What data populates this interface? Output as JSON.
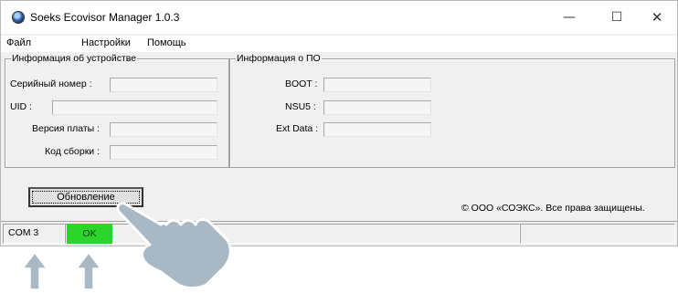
{
  "window": {
    "title": "Soeks Ecovisor Manager 1.0.3",
    "controls": {
      "minimize": "—",
      "maximize": "☐",
      "close": "✕"
    }
  },
  "menu": {
    "file": "Файл",
    "settings": "Настройки",
    "help": "Помощь"
  },
  "device_info": {
    "legend": "Информация об устройстве",
    "serial_label": "Серийный номер :",
    "serial_value": "",
    "uid_label": "UID :",
    "uid_value": "",
    "board_version_label": "Версия платы :",
    "board_version_value": "",
    "build_code_label": "Код сборки :",
    "build_code_value": ""
  },
  "software_info": {
    "legend": "Информация о ПО",
    "boot_label": "BOOT :",
    "boot_value": "",
    "nsu5_label": "NSU5 :",
    "nsu5_value": "",
    "ext_data_label": "Ext Data :",
    "ext_data_value": ""
  },
  "actions": {
    "update_button": "Обновление"
  },
  "copyright": "© ООО «СОЭКС». Все права защищены.",
  "status": {
    "port": "COM 3",
    "connection": "OK",
    "connection_color": "#2bd52b"
  },
  "colors": {
    "window_bg": "#f0f0f0",
    "overlay_gray": "#a9b8c5"
  }
}
